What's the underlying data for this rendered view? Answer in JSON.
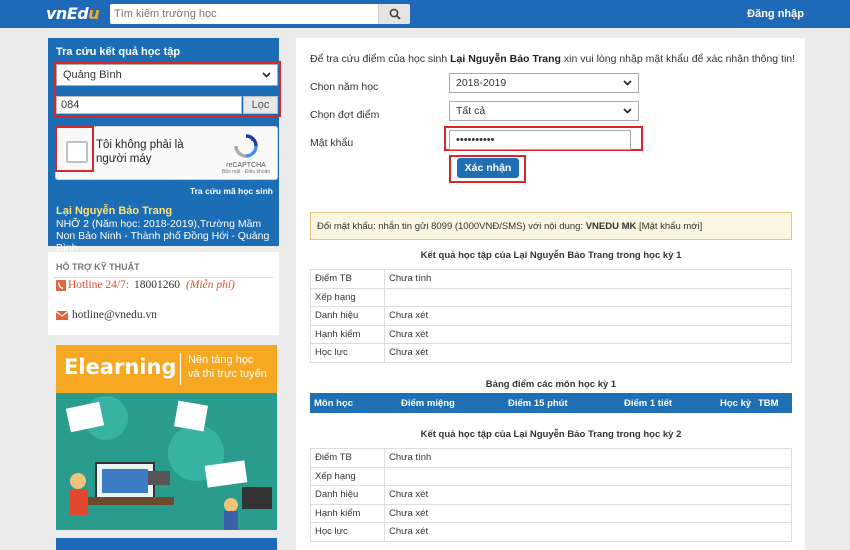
{
  "header": {
    "logo_text": "vnEdu",
    "search_placeholder": "Tìm kiếm trường học",
    "login": "Đăng nhập"
  },
  "sidebar": {
    "title": "Tra cứu kết quả học tập",
    "province": "Quảng Bình",
    "student_code": "084",
    "filter_button": "Lọc",
    "captcha_label": "Tôi không phải là người máy",
    "captcha_brand": "reCAPTCHA",
    "captcha_terms": "Bảo mật - Điều khoản",
    "lookup_code_link": "Tra cứu mã học sinh",
    "student_name": "Lại Nguyễn Bảo Trang",
    "student_info": "NHỠ 2 (Năm học: 2018-2019),Trường Mầm Non Bảo Ninh - Thành phố Đồng Hới - Quảng Bình"
  },
  "support": {
    "title": "HỖ TRỢ KỸ THUẬT",
    "hotline_label": "Hotline 24/7:",
    "hotline_number": "18001260",
    "hotline_note": "(Miễn phí)",
    "email": "hotline@vnedu.vn"
  },
  "banner": {
    "title": "Elearning",
    "subtitle_line1": "Nền tảng học",
    "subtitle_line2": "và thi trực tuyến"
  },
  "form": {
    "intro_prefix": "Để tra cứu điểm của học sinh ",
    "intro_name": "Lại Nguyễn Bảo Trang",
    "intro_suffix": " xin vui lòng nhập mật khẩu để xác nhận thông tin!",
    "year_label": "Chọn năm học",
    "year_value": "2018-2019",
    "period_label": "Chọn đợt điểm",
    "period_value": "Tất cả",
    "password_label": "Mật khẩu",
    "password_value": "••••••••••",
    "confirm_button": "Xác nhận"
  },
  "sms_notice": {
    "prefix": "Đổi mật khẩu: nhắn tin gửi 8099 (1000VNĐ/SMS) với nội dung: ",
    "command": "VNEDU MK",
    "suffix": " [Mật khẩu mới]"
  },
  "semester1": {
    "title": "Kết quả học tập của Lại Nguyễn Bảo Trang trong học kỳ 1",
    "rows": [
      {
        "label": "Điểm TB",
        "value": "Chưa tính"
      },
      {
        "label": "Xếp hạng",
        "value": ""
      },
      {
        "label": "Danh hiệu",
        "value": "Chưa xét"
      },
      {
        "label": "Hạnh kiểm",
        "value": "Chưa xét"
      },
      {
        "label": "Học lực",
        "value": "Chưa xét"
      }
    ]
  },
  "subjects": {
    "title": "Bảng điểm các môn học kỳ 1",
    "columns": [
      "Môn học",
      "Điểm miệng",
      "Điểm 15 phút",
      "Điểm 1 tiết",
      "Học kỳ",
      "TBM"
    ]
  },
  "semester2": {
    "title": "Kết quả học tập của Lại Nguyễn Bảo Trang trong học kỳ 2",
    "rows": [
      {
        "label": "Điểm TB",
        "value": "Chưa tính"
      },
      {
        "label": "Xếp hạng",
        "value": ""
      },
      {
        "label": "Danh hiệu",
        "value": "Chưa xét"
      },
      {
        "label": "Hạnh kiểm",
        "value": "Chưa xét"
      },
      {
        "label": "Học lực",
        "value": "Chưa xét"
      }
    ]
  },
  "colors": {
    "brand_blue": "#1f6ab8",
    "highlight_red": "#d9262b",
    "banner_orange": "#f7a823",
    "banner_teal": "#2a9c8e"
  }
}
